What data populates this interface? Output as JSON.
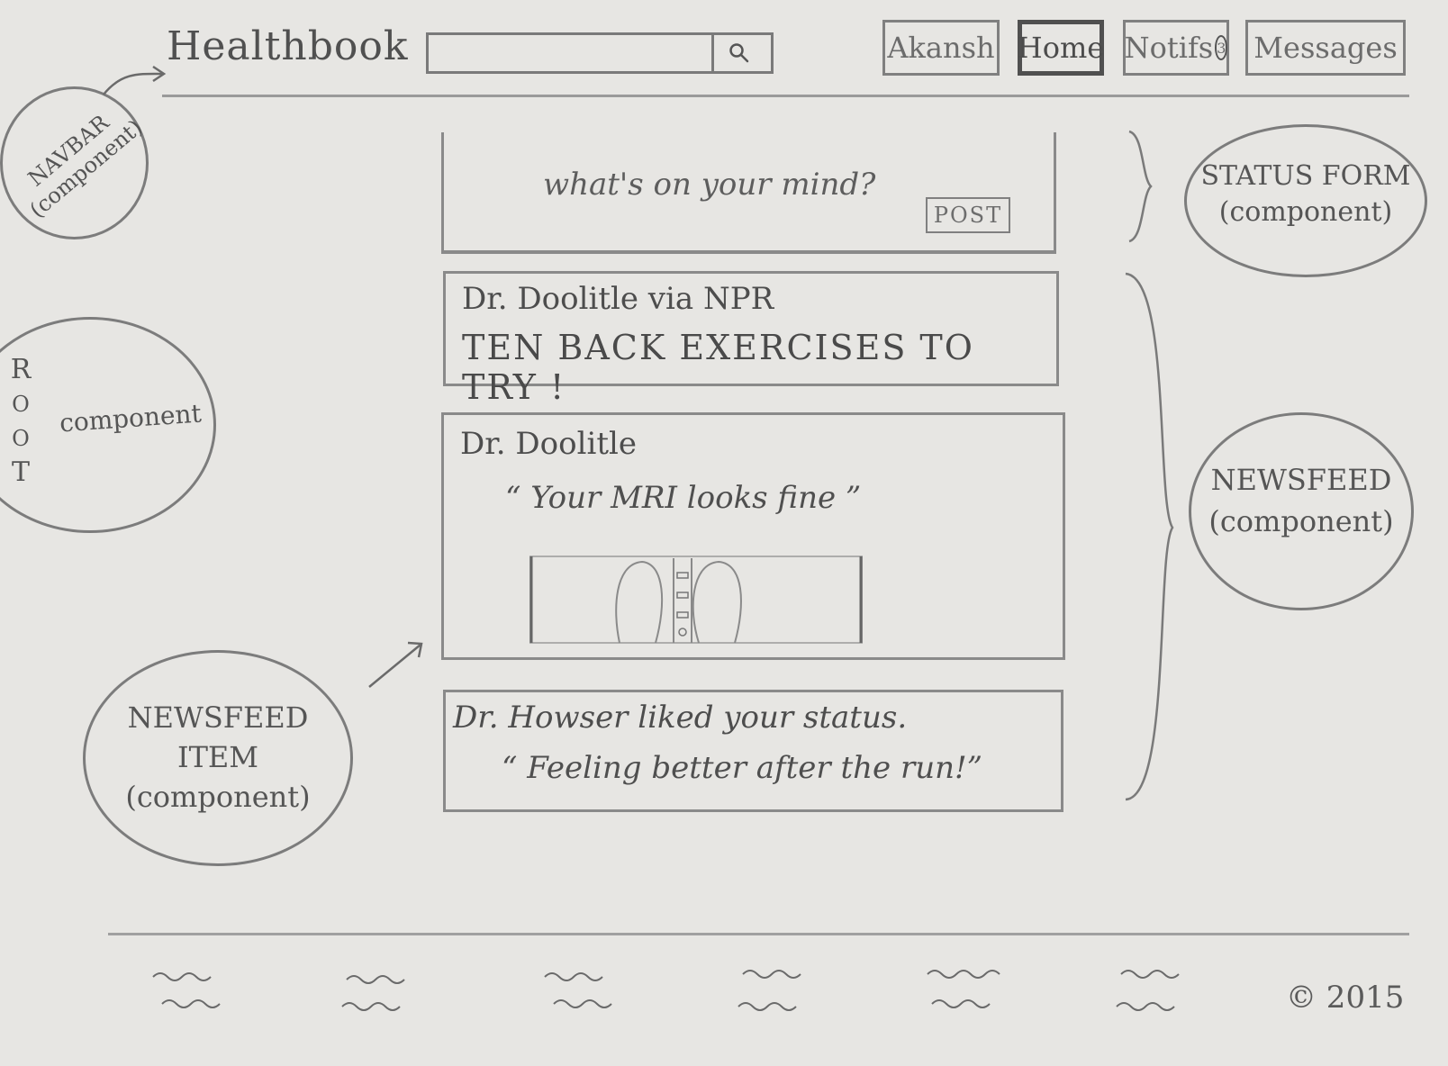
{
  "navbar": {
    "brand": "Healthbook",
    "search": {
      "value": "",
      "placeholder": ""
    },
    "search_icon": "search-icon",
    "buttons": {
      "user": "Akansh",
      "home": "Home",
      "notifs": "Notifs",
      "notifs_count": "3",
      "messages": "Messages"
    }
  },
  "status_form": {
    "prompt": "what's on your mind?",
    "post_label": "POST"
  },
  "newsfeed": {
    "items": [
      {
        "author": "Dr. Doolitle via NPR",
        "body": "TEN BACK EXERCISES TO TRY !"
      },
      {
        "author": "Dr. Doolitle",
        "quote": "“ Your MRI looks fine ”",
        "image": "mri-scan-image"
      },
      {
        "author": "Dr. Howser liked your status.",
        "quote": "“ Feeling better after the run!”"
      }
    ]
  },
  "annotations": {
    "navbar_line1": "NAVBAR",
    "navbar_line2": "(component)",
    "root_letters": [
      "R",
      "O",
      "O",
      "T"
    ],
    "root_word": "component",
    "status_form_line1": "STATUS FORM",
    "status_form_line2": "(component)",
    "newsfeed_line1": "NEWSFEED",
    "newsfeed_line2": "(component)",
    "newsfeed_item_line1": "NEWSFEED",
    "newsfeed_item_line2": "ITEM",
    "newsfeed_item_line3": "(component)"
  },
  "footer": {
    "copyright": "© 2015"
  }
}
